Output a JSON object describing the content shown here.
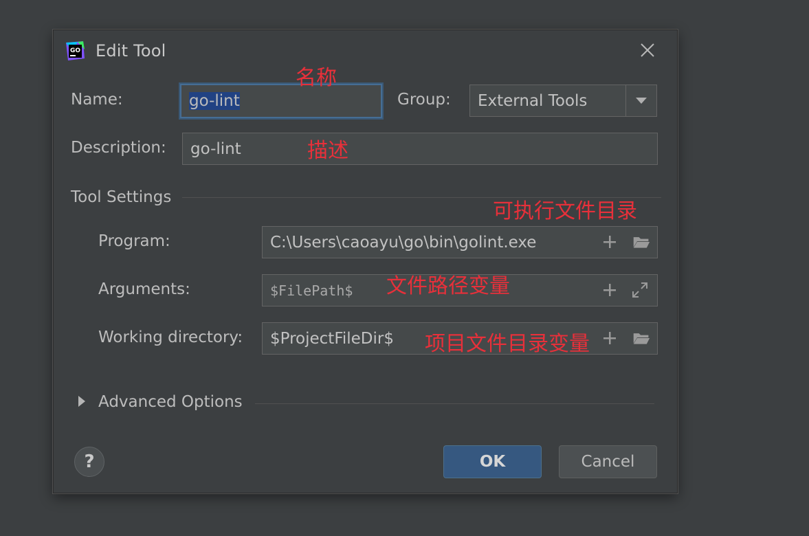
{
  "dialog": {
    "title": "Edit Tool",
    "icon": "goland-icon"
  },
  "form": {
    "name_label": "Name:",
    "name_value": "go-lint",
    "group_label": "Group:",
    "group_value": "External Tools",
    "description_label": "Description:",
    "description_value": "go-lint"
  },
  "tool_settings": {
    "section_title": "Tool Settings",
    "program_label": "Program:",
    "program_value": "C:\\Users\\caoayu\\go\\bin\\golint.exe",
    "arguments_label": "Arguments:",
    "arguments_value": "$FilePath$",
    "working_dir_label": "Working directory:",
    "working_dir_value": "$ProjectFileDir$"
  },
  "advanced": {
    "label": "Advanced Options"
  },
  "buttons": {
    "help": "?",
    "ok": "OK",
    "cancel": "Cancel"
  },
  "annotations": {
    "name_note": "名称",
    "description_note": "描述",
    "program_note": "可执行文件目录",
    "arguments_note": "文件路径变量",
    "working_dir_note": "项目文件目录变量"
  },
  "colors": {
    "background": "#3c3f41",
    "annotation": "#e8303a",
    "accent": "#365880"
  }
}
